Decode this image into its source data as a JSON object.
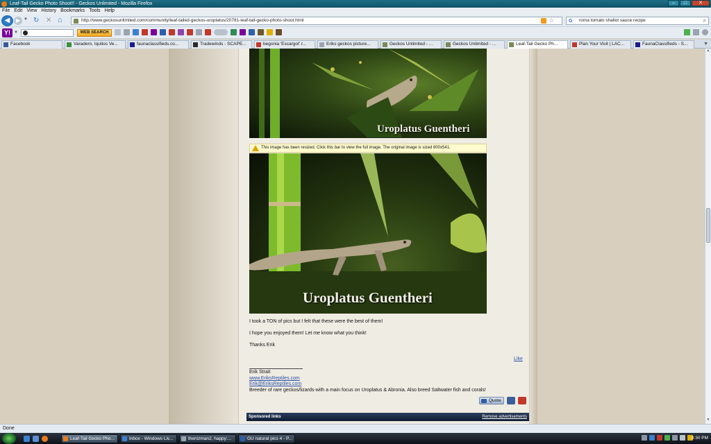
{
  "window": {
    "title": "Leaf-Tail Gecko Photo Shoot!! - Geckos Unlimited - Mozilla Firefox"
  },
  "menu": [
    "File",
    "Edit",
    "View",
    "History",
    "Bookmarks",
    "Tools",
    "Help"
  ],
  "nav": {
    "url": "http://www.geckosunlimited.com/community/leaf-tailed-geckos-uroplatus/20781-leaf-tail-gecko-photo-shoot.html",
    "search_value": "roma tomato shallot sauce recipe"
  },
  "yahoo_toolbar": {
    "search_button": "WEB SEARCH"
  },
  "tabs": [
    {
      "label": "Facebook",
      "color": "#3b5998"
    },
    {
      "label": "Varadero, Iquitos Ve...",
      "color": "#3d8f3d"
    },
    {
      "label": "faunaclassifieds.co...",
      "color": "#1a1a8c"
    },
    {
      "label": "Tradewinds - SCAPE...",
      "color": "#2b2b2b"
    },
    {
      "label": "begonia 'Escargot' r...",
      "color": "#c0392b"
    },
    {
      "label": "Eriks geckos picture...",
      "color": "#9aa4b0"
    },
    {
      "label": "Geckos Unlimited - ...",
      "color": "#7a8a5a"
    },
    {
      "label": "Geckos Unlimited - ...",
      "color": "#7a8a5a"
    },
    {
      "label": "Leaf-Tail Gecko Ph...",
      "color": "#7a8a5a",
      "active": true
    },
    {
      "label": "Plan Your Visit | LAC...",
      "color": "#c0392b"
    },
    {
      "label": "FaunaClassifieds - S...",
      "color": "#1a1a8c"
    }
  ],
  "post": {
    "photo1_caption": "Uroplatus Guentheri",
    "resize_notice": "This image has been resized. Click this bar to view the full image. The original image is sized 800x541.",
    "photo2_caption": "Uroplatus Guentheri",
    "line1": "I took a TON of pics but I felt that these were the best of them!",
    "line2": "I hope you enjoyed them! Let me know what you think!",
    "line3": "Thanks Erik",
    "like": "Like",
    "sig_name": "Erik Strait",
    "sig_link1": "www.EriksReptiles.com",
    "sig_link2": "Erik@EriksReptiles.com",
    "sig_bio": "Breeder of rare geckos/lizards-with a main focus on Uroplatus & Abronia. Also breed Saltwater fish and corals!",
    "quote_button": "Quote"
  },
  "sponsored": {
    "title": "Sponsored links",
    "remove": "Remove advertisements"
  },
  "status": "Done",
  "taskbar": {
    "tasks": [
      {
        "label": "Leaf-Tail Gecko Pho...",
        "color": "#e97b1c",
        "active": true
      },
      {
        "label": "Inbox - Windows Liv...",
        "color": "#3d7fd1"
      },
      {
        "label": "thenizman2, happy:...",
        "color": "#9aa4b0"
      },
      {
        "label": "GU natural pics 4 - P...",
        "color": "#2f5fa8"
      }
    ],
    "clock": "8:30 PM"
  }
}
